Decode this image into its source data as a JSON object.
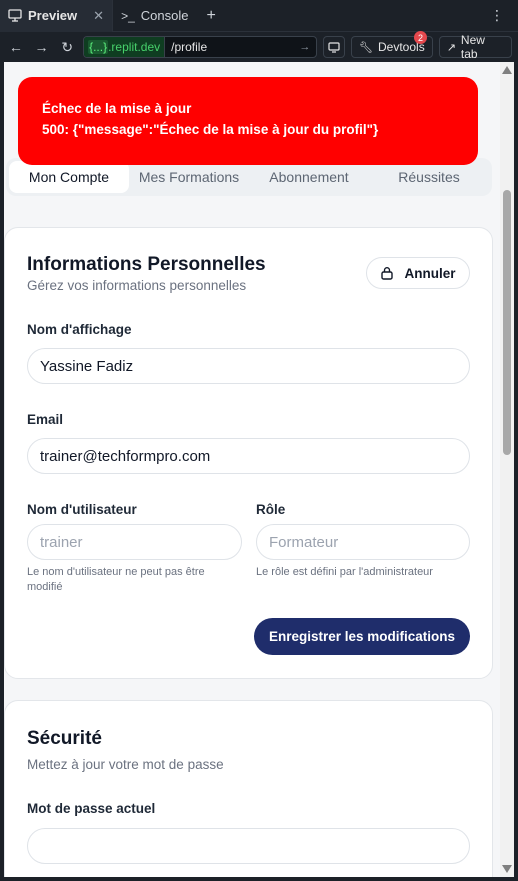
{
  "browser": {
    "tabs": [
      {
        "label": "Preview",
        "icon": "monitor-icon"
      },
      {
        "label": "Console",
        "icon": "terminal-icon"
      }
    ],
    "new_tab_symbol": "+",
    "url_domain_badge": "{...}",
    "url_domain": ".replit.dev",
    "url_path": "/profile",
    "devtools_label": "Devtools",
    "devtools_badge": "2",
    "new_tab_label": "New tab"
  },
  "toast": {
    "title": "Échec de la mise à jour",
    "message": "500: {\"message\":\"Échec de la mise à jour du profil\"}",
    "color": "#ff0000"
  },
  "tabs": [
    "Mon Compte",
    "Mes Formations",
    "Abonnement",
    "Réussites"
  ],
  "personal": {
    "title": "Informations Personnelles",
    "subtitle": "Gérez vos informations personnelles",
    "cancel_label": "Annuler",
    "display_name_label": "Nom d'affichage",
    "display_name_value": "Yassine Fadiz",
    "email_label": "Email",
    "email_value": "trainer@techformpro.com",
    "username_label": "Nom d'utilisateur",
    "username_value": "trainer",
    "username_hint": "Le nom d'utilisateur ne peut pas être modifié",
    "role_label": "Rôle",
    "role_value": "Formateur",
    "role_hint": "Le rôle est défini par l'administrateur",
    "save_label": "Enregistrer les modifications"
  },
  "security": {
    "title": "Sécurité",
    "subtitle": "Mettez à jour votre mot de passe",
    "current_password_label": "Mot de passe actuel",
    "current_password_value": ""
  },
  "colors": {
    "primary": "#1f2d6b",
    "error": "#ff0000"
  }
}
